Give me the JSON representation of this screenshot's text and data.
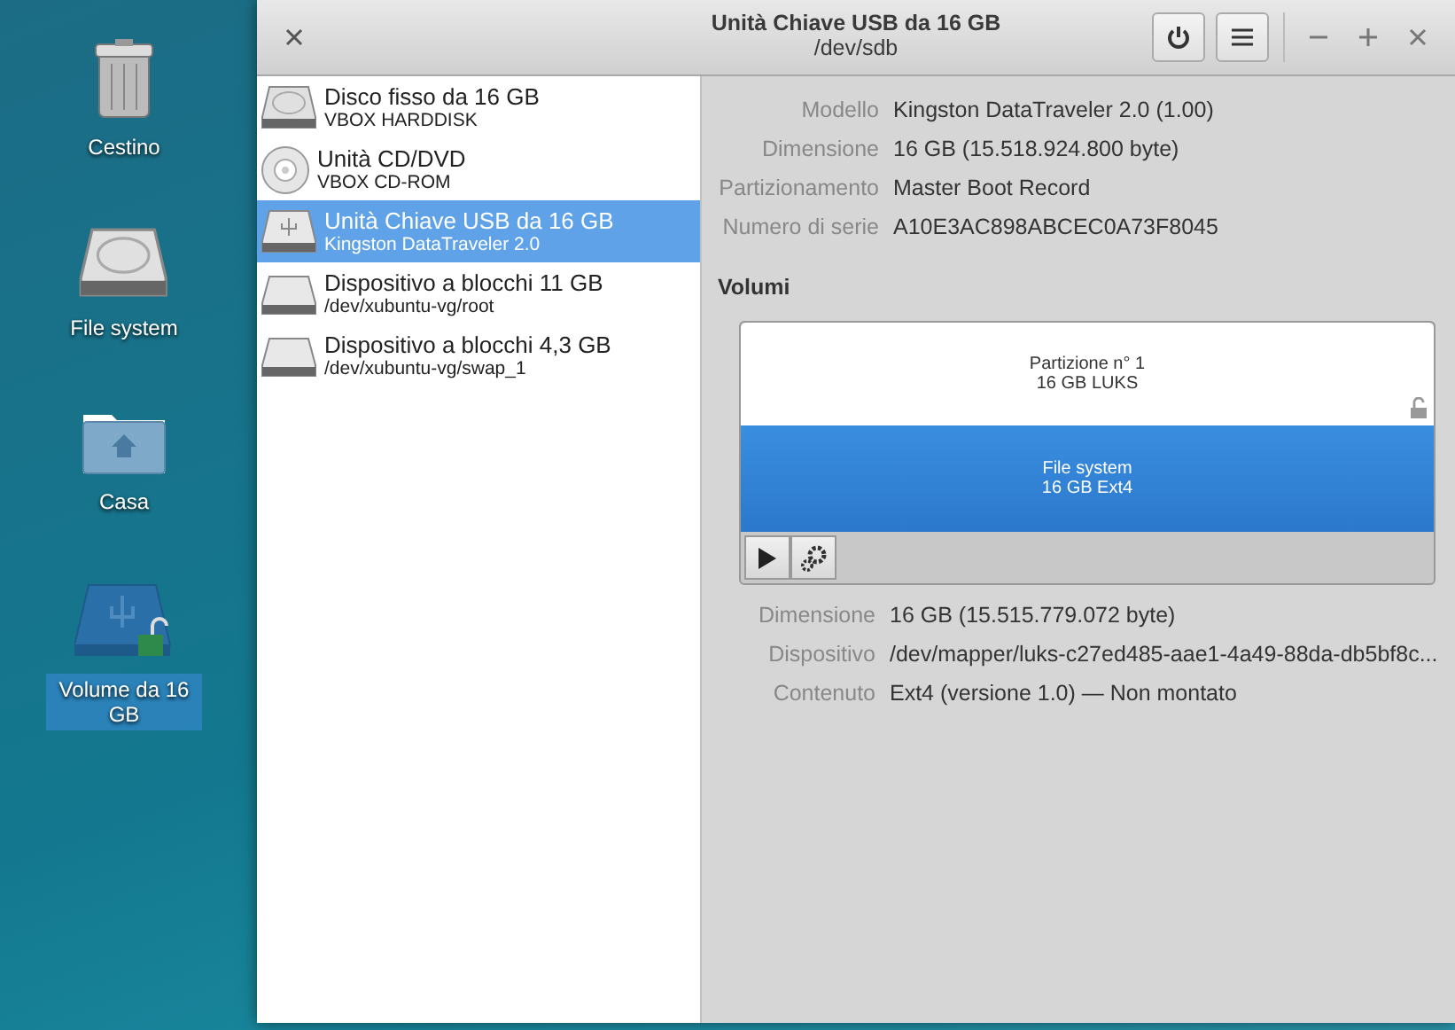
{
  "desktop_icons": [
    {
      "label": "Cestino",
      "kind": "trash",
      "selected": false
    },
    {
      "label": "File system",
      "kind": "harddisk",
      "selected": false
    },
    {
      "label": "Casa",
      "kind": "home",
      "selected": false
    },
    {
      "label": "Volume da 16 GB",
      "kind": "usb",
      "selected": true
    }
  ],
  "window": {
    "title": "Unità Chiave USB da 16 GB",
    "subtitle": "/dev/sdb"
  },
  "devices": [
    {
      "name": "Disco fisso da 16 GB",
      "detail": "VBOX HARDDISK",
      "kind": "harddisk",
      "selected": false
    },
    {
      "name": "Unità CD/DVD",
      "detail": "VBOX CD-ROM",
      "kind": "cdrom",
      "selected": false
    },
    {
      "name": "Unità Chiave USB da 16 GB",
      "detail": "Kingston DataTraveler 2.0",
      "kind": "usb",
      "selected": true
    },
    {
      "name": "Dispositivo a blocchi 11 GB",
      "detail": "/dev/xubuntu-vg/root",
      "kind": "block",
      "selected": false
    },
    {
      "name": "Dispositivo a blocchi 4,3 GB",
      "detail": "/dev/xubuntu-vg/swap_1",
      "kind": "block",
      "selected": false
    }
  ],
  "drive_details": [
    {
      "label": "Modello",
      "value": "Kingston DataTraveler 2.0 (1.00)"
    },
    {
      "label": "Dimensione",
      "value": "16 GB (15.518.924.800 byte)"
    },
    {
      "label": "Partizionamento",
      "value": "Master Boot Record"
    },
    {
      "label": "Numero di serie",
      "value": "A10E3AC898ABCEC0A73F8045"
    }
  ],
  "volumes_heading": "Volumi",
  "volumes": [
    {
      "kind": "partition",
      "name": "Partizione n° 1",
      "size": "16 GB LUKS",
      "unlocked": true,
      "selected": false
    },
    {
      "kind": "filesystem",
      "name": "File system",
      "size": "16 GB Ext4",
      "unlocked": false,
      "selected": true
    }
  ],
  "volume_details": [
    {
      "label": "Dimensione",
      "value": "16 GB (15.515.779.072 byte)"
    },
    {
      "label": "Dispositivo",
      "value": "/dev/mapper/luks-c27ed485-aae1-4a49-88da-db5bf8c..."
    },
    {
      "label": "Contenuto",
      "value": "Ext4 (versione 1.0) — Non montato"
    }
  ]
}
